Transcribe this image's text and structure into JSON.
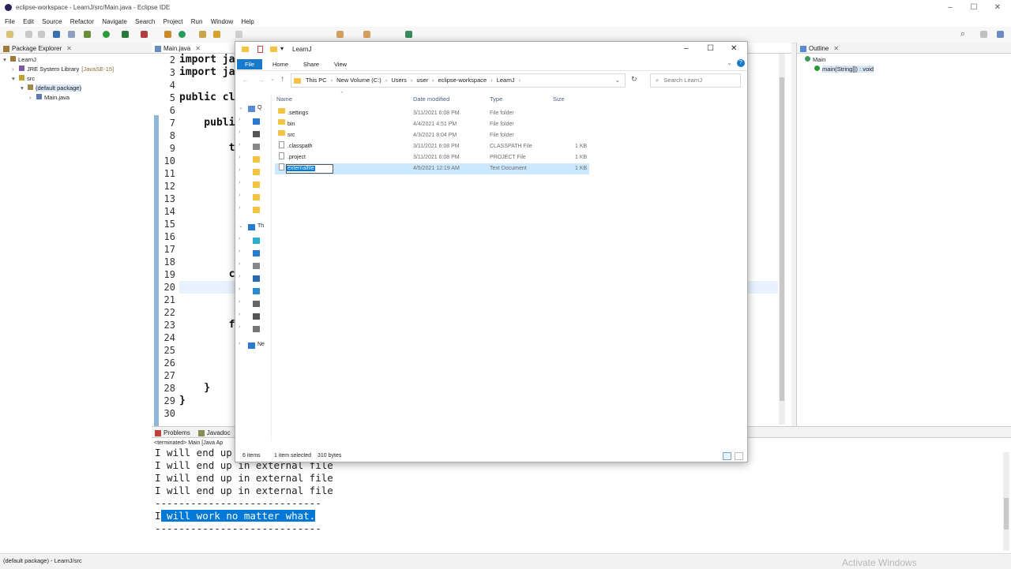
{
  "eclipse": {
    "title": "eclipse-workspace - LearnJ/src/Main.java - Eclipse IDE",
    "menu": [
      "File",
      "Edit",
      "Source",
      "Refactor",
      "Navigate",
      "Search",
      "Project",
      "Run",
      "Window",
      "Help"
    ],
    "package_explorer": {
      "tab": "Package Explorer",
      "tree": [
        {
          "label": "LearnJ",
          "indent": 0,
          "arrow": "▾"
        },
        {
          "label": "JRE System Library",
          "suffix": "[JavaSE-15]",
          "indent": 1,
          "arrow": "›"
        },
        {
          "label": "src",
          "indent": 1,
          "arrow": "▾"
        },
        {
          "label": "(default package)",
          "indent": 2,
          "arrow": "▾"
        },
        {
          "label": "Main.java",
          "indent": 3,
          "arrow": "›"
        }
      ]
    },
    "editor": {
      "tab": "Main.java",
      "line_numbers": [
        "2",
        "3",
        "4",
        "5",
        "6",
        "7",
        "8",
        "9",
        "10",
        "11",
        "12",
        "13",
        "14",
        "15",
        "16",
        "17",
        "18",
        "19",
        "20",
        "21",
        "22",
        "23",
        "24",
        "25",
        "26",
        "27",
        "28",
        "29",
        "30"
      ],
      "code_lines": [
        "import ja",
        "import ja",
        "",
        "public cl",
        "",
        "    publi",
        "",
        "        t",
        "",
        "",
        "",
        "",
        "",
        "",
        "",
        "",
        "",
        "        c",
        "",
        "",
        "",
        "        f",
        "",
        "",
        "",
        "",
        "    }",
        "}",
        ""
      ]
    },
    "outline": {
      "tab": "Outline",
      "items": [
        {
          "label": "Main",
          "indent": 0
        },
        {
          "label": "main(String[]) : void",
          "indent": 1
        }
      ]
    },
    "console": {
      "tabs": [
        "Problems",
        "Javadoc"
      ],
      "terminated": "<terminated> Main [Java Ap",
      "lines": [
        "I will end up in external file",
        "I will end up in external file",
        "I will end up in external file",
        "I will end up in external file",
        "----------------------------"
      ],
      "highlight_prefix": "I",
      "highlight_text": " will work no matter what.",
      "last_line": "----------------------------"
    },
    "status": "(default package) - LearnJ/src",
    "watermark": "Activate Windows"
  },
  "explorer": {
    "title": "LearnJ",
    "ribbon_tabs": [
      "File",
      "Home",
      "Share",
      "View"
    ],
    "breadcrumb": [
      "This PC",
      "New Volume (C:)",
      "Users",
      "user",
      "eclipse-workspace",
      "LearnJ"
    ],
    "search_placeholder": "Search LearnJ",
    "columns": {
      "name": "Name",
      "date": "Date modified",
      "type": "Type",
      "size": "Size"
    },
    "files": [
      {
        "name": ".settings",
        "date": "3/11/2021 6:08 PM",
        "type": "File folder",
        "size": "",
        "kind": "folder"
      },
      {
        "name": "bin",
        "date": "4/4/2021 4:51 PM",
        "type": "File folder",
        "size": "",
        "kind": "folder"
      },
      {
        "name": "src",
        "date": "4/3/2021 8:04 PM",
        "type": "File folder",
        "size": "",
        "kind": "folder"
      },
      {
        "name": ".classpath",
        "date": "3/11/2021 6:08 PM",
        "type": "CLASSPATH File",
        "size": "1 KB",
        "kind": "file"
      },
      {
        "name": ".project",
        "date": "3/11/2021 6:08 PM",
        "type": "PROJECT File",
        "size": "1 KB",
        "kind": "file"
      },
      {
        "name": "externalfile",
        "date": "4/5/2021 12:19 AM",
        "type": "Text Document",
        "size": "1 KB",
        "kind": "file",
        "selected": true
      }
    ],
    "nav": [
      "Q",
      "Th",
      "Ne"
    ],
    "status_items": "6 items",
    "status_selected": "1 item selected",
    "status_size": "310 bytes"
  },
  "colors": {
    "selection": "#cce8ff",
    "highlight": "#0078d7",
    "folder": "#f3c443"
  }
}
